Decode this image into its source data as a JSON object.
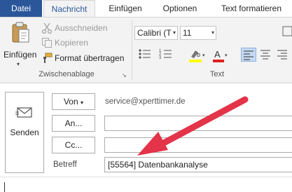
{
  "tabs": {
    "file": "Datei",
    "message": "Nachricht",
    "insert": "Einfügen",
    "options": "Optionen",
    "format": "Text formatieren"
  },
  "clipboard": {
    "paste": "Einfügen",
    "cut": "Ausschneiden",
    "copy": "Kopieren",
    "format_painter": "Format übertragen",
    "group_label": "Zwischenablage"
  },
  "text_group": {
    "font": "Calibri (T",
    "size": "11",
    "group_label": "Text",
    "highlight_color": "#ffff00",
    "font_color": "#e02020"
  },
  "compose": {
    "send": "Senden",
    "from_button": "Von",
    "from_value": "service@xperttimer.de",
    "to_button": "An...",
    "cc_button": "Cc...",
    "subject_label": "Betreff",
    "subject_value": "[55564] Datenbankanalyse"
  },
  "annotation": {
    "arrow_color": "#e3344a"
  },
  "colors": {
    "accent": "#2b579a"
  }
}
